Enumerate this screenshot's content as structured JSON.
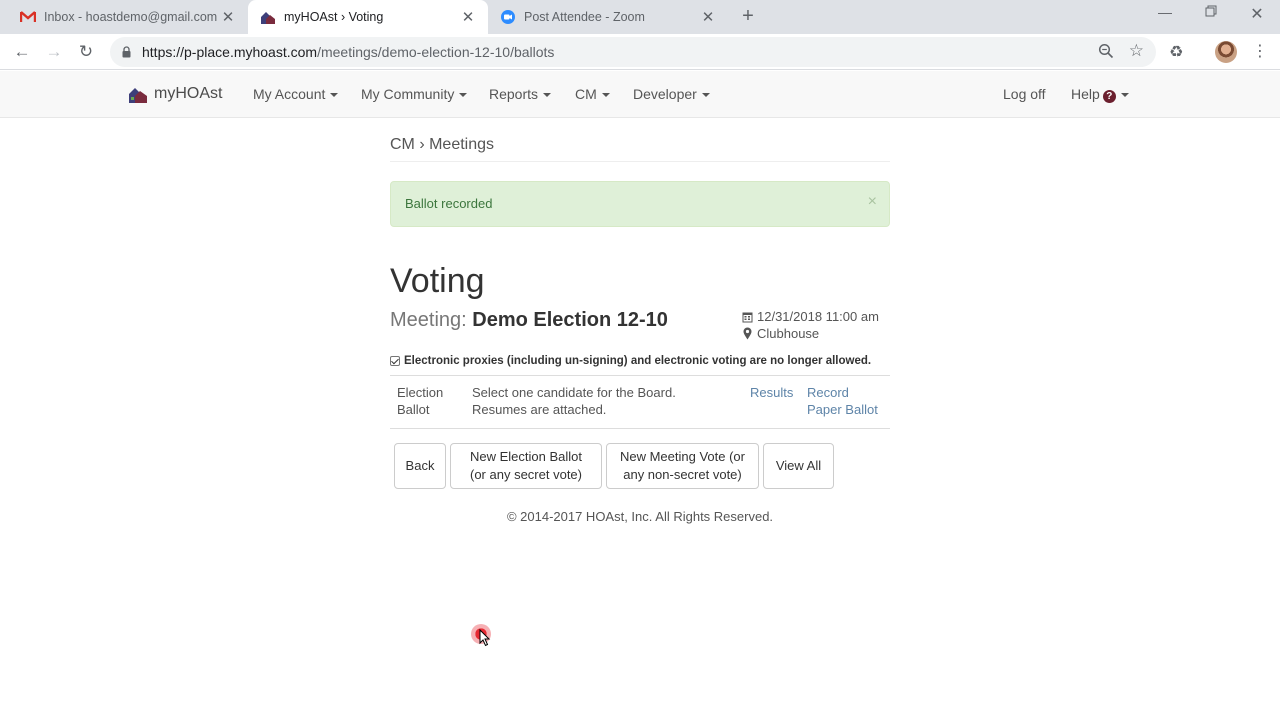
{
  "browser": {
    "tabs": [
      {
        "title": "Inbox - hoastdemo@gmail.com",
        "icon": "gmail-icon",
        "active": false
      },
      {
        "title": "myHOAst › Voting",
        "icon": "myhoast-icon",
        "active": true
      },
      {
        "title": "Post Attendee - Zoom",
        "icon": "zoom-icon",
        "active": false
      }
    ],
    "url_host": "https://p-place.myhoast.com",
    "url_path": "/meetings/demo-election-12-10/ballots"
  },
  "site": {
    "brand": "myHOAst",
    "menu": [
      "My Account",
      "My Community",
      "Reports",
      "CM",
      "Developer"
    ],
    "logoff": "Log off",
    "help": "Help"
  },
  "page": {
    "breadcrumb": "CM › Meetings",
    "alert": "Ballot recorded",
    "alert_close": "×",
    "title": "Voting",
    "meeting_label": "Meeting:",
    "meeting_name": "Demo Election 12-10",
    "datetime": "12/31/2018 11:00 am",
    "location": "Clubhouse",
    "notice": "Electronic proxies (including un-signing) and electronic voting are no longer allowed.",
    "ballot": {
      "name_line1": "Election",
      "name_line2": "Ballot",
      "desc_line1": "Select one candidate for the Board.",
      "desc_line2": "Resumes are attached.",
      "results": "Results",
      "record_line1": "Record",
      "record_line2": "Paper Ballot"
    },
    "buttons": {
      "back": "Back",
      "new_election_1": "New Election Ballot",
      "new_election_2": "(or any secret vote)",
      "new_meeting_1": "New Meeting Vote (or",
      "new_meeting_2": "any non-secret vote)",
      "view_all": "View All"
    },
    "footer": "© 2014-2017 HOAst, Inc. All Rights Reserved."
  },
  "colors": {
    "alert_bg": "#dff0d8",
    "alert_text": "#3c763d",
    "link": "#5e84a8",
    "help_badge": "#6b1f2e"
  }
}
